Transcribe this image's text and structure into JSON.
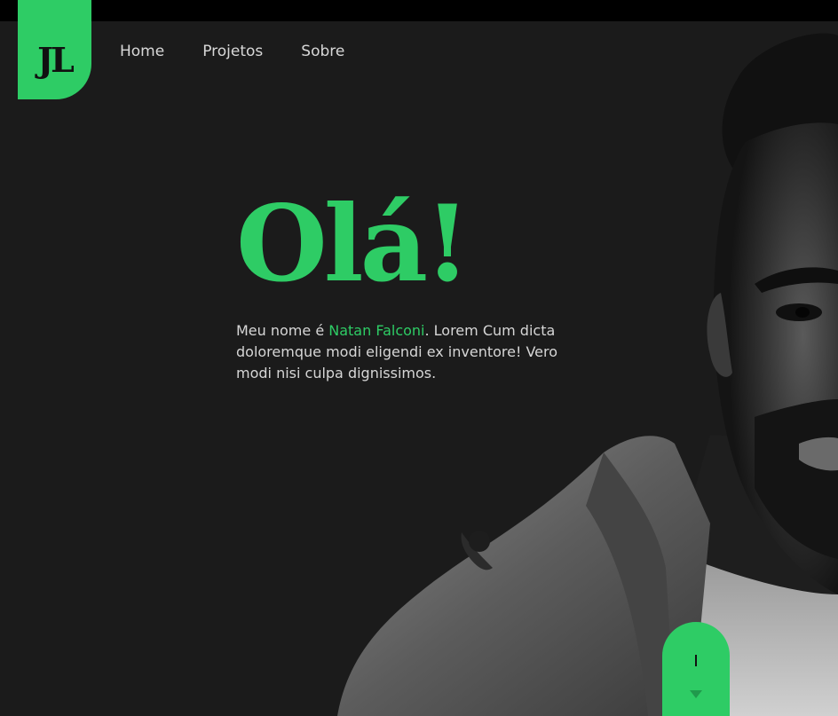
{
  "brand": {
    "logo_text": "JL",
    "accent": "#2ecc65",
    "background": "#1b1b1b"
  },
  "nav": {
    "items": [
      {
        "label": "Home"
      },
      {
        "label": "Projetos"
      },
      {
        "label": "Sobre"
      }
    ]
  },
  "hero": {
    "title": "Olá!",
    "text_before": "Meu nome é ",
    "name": "Natan Falconi",
    "text_after": ". Lorem Cum dicta doloremque modi eligendi ex inventore! Vero modi nisi culpa dignissimos."
  },
  "portrait": {
    "icon": "person-photo",
    "style": "grayscale"
  },
  "scroll_indicator": {
    "icon": "chevron-down-icon"
  }
}
